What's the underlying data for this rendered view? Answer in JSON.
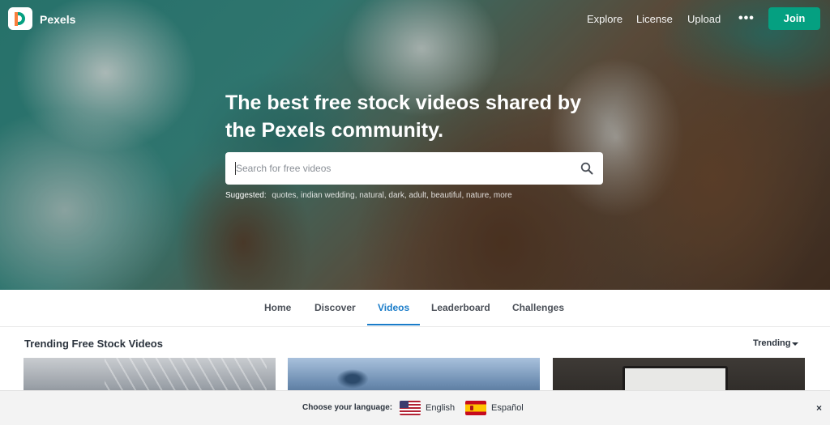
{
  "nav": {
    "brand": "Pexels",
    "links": [
      "Explore",
      "License",
      "Upload"
    ],
    "more": "•••",
    "join_label": "Join"
  },
  "hero": {
    "headline": "The best free stock videos shared by the Pexels community.",
    "search_placeholder": "Search for free videos",
    "suggested_label": "Suggested:",
    "suggested_items": "quotes, indian wedding, natural, dark, adult, beautiful, nature, more"
  },
  "tabs": {
    "items": [
      "Home",
      "Discover",
      "Videos",
      "Leaderboard",
      "Challenges"
    ],
    "active": "Videos"
  },
  "section": {
    "title": "Trending Free Stock Videos",
    "sort_label": "Trending"
  },
  "language_bar": {
    "title": "Choose your language:",
    "options": [
      "English",
      "Español"
    ],
    "close": "×"
  },
  "colors": {
    "accent": "#05a081",
    "tab_active": "#1a7cc9"
  },
  "icons": [
    "search-icon",
    "more-icon",
    "chevron-down-icon",
    "close-icon",
    "us-flag-icon",
    "es-flag-icon"
  ]
}
